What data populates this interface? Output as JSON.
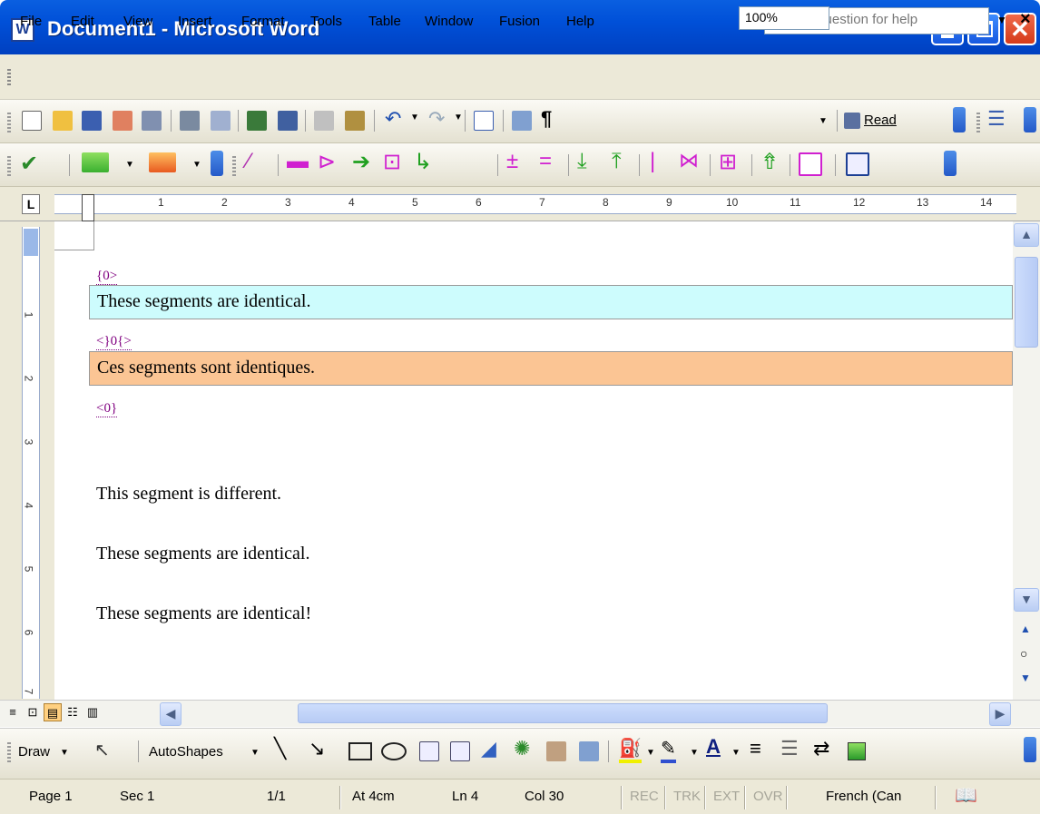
{
  "window": {
    "title": "Document1 - Microsoft Word"
  },
  "menu": {
    "items": [
      "File",
      "Edit",
      "View",
      "Insert",
      "Format",
      "Tools",
      "Table",
      "Window",
      "Fusion",
      "Help"
    ],
    "help_placeholder": "Type a question for help"
  },
  "standard_toolbar": {
    "zoom": "100%",
    "read_label": "Read"
  },
  "ruler": {
    "numbers": [
      "1",
      "2",
      "3",
      "4",
      "5",
      "6",
      "7",
      "8",
      "9",
      "10",
      "11",
      "12",
      "13",
      "14"
    ]
  },
  "document": {
    "tag_open": "{0>",
    "source_segment": "These segments are identical.",
    "tag_mid": "<}0{>",
    "target_segment": "Ces segments sont identiques.",
    "tag_close": "<0}",
    "paragraphs": [
      "This segment is different.",
      "These segments are identical.",
      "These segments are identical!"
    ],
    "source_color": "#cdfcfd",
    "target_color": "#fbc594"
  },
  "drawing_toolbar": {
    "draw_label": "Draw",
    "autoshapes_label": "AutoShapes"
  },
  "status": {
    "page": "Page 1",
    "section": "Sec 1",
    "pages": "1/1",
    "at": "At 4cm",
    "line": "Ln 4",
    "col": "Col 30",
    "rec": "REC",
    "trk": "TRK",
    "ext": "EXT",
    "ovr": "OVR",
    "language": "French (Can"
  }
}
